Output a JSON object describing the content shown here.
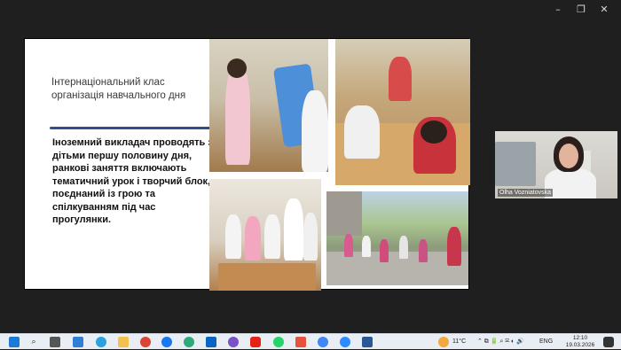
{
  "window_controls": {
    "minimize": "–",
    "maximize": "❐",
    "close": "✕"
  },
  "slide": {
    "title": "Інтернаціональний клас організація навчального дня",
    "body": "Іноземний викладач проводять з дітьми першу половину дня, ранкові заняття включають тематичний урок і творчий блок, поєднаний із грою та спілкуванням під час прогулянки.",
    "accent": "#2e4f8c"
  },
  "video": {
    "participant_name": "Olha Vozniatovska"
  },
  "taskbar": {
    "icons": [
      "windows-start-icon",
      "search-icon",
      "task-view-icon",
      "widgets-icon",
      "telegram-icon",
      "file-explorer-icon",
      "chrome-icon",
      "facebook-icon",
      "edge-icon",
      "outlook-icon",
      "viber-icon",
      "youtube-icon",
      "whatsapp-icon",
      "store-icon",
      "chrome-profile-icon",
      "zoom-icon",
      "word-icon"
    ],
    "weather": "11°C",
    "language": "ENG",
    "time": "12:10",
    "date": "19.03.2026"
  }
}
